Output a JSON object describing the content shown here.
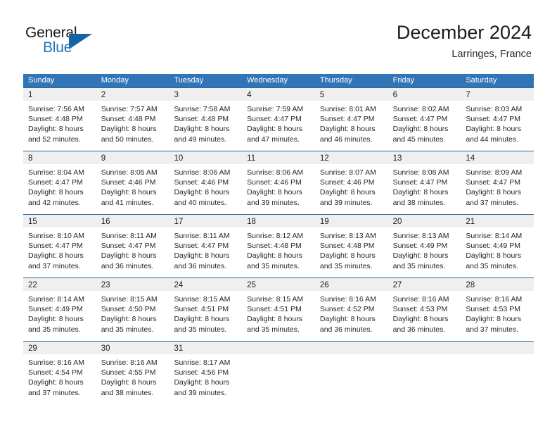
{
  "brand": {
    "name_part1": "General",
    "name_part2": "Blue",
    "flag_icon": "triangle-flag-icon"
  },
  "header": {
    "title": "December 2024",
    "location": "Larringes, France"
  },
  "colors": {
    "header_blue": "#3275b7",
    "row_border_blue": "#2a6aa8",
    "date_band_gray": "#efefef",
    "brand_blue": "#1f73b8",
    "text": "#262626"
  },
  "calendar": {
    "weekday_headers": [
      "Sunday",
      "Monday",
      "Tuesday",
      "Wednesday",
      "Thursday",
      "Friday",
      "Saturday"
    ],
    "weeks": [
      [
        {
          "day": "1",
          "lines": [
            "Sunrise: 7:56 AM",
            "Sunset: 4:48 PM",
            "Daylight: 8 hours",
            "and 52 minutes."
          ]
        },
        {
          "day": "2",
          "lines": [
            "Sunrise: 7:57 AM",
            "Sunset: 4:48 PM",
            "Daylight: 8 hours",
            "and 50 minutes."
          ]
        },
        {
          "day": "3",
          "lines": [
            "Sunrise: 7:58 AM",
            "Sunset: 4:48 PM",
            "Daylight: 8 hours",
            "and 49 minutes."
          ]
        },
        {
          "day": "4",
          "lines": [
            "Sunrise: 7:59 AM",
            "Sunset: 4:47 PM",
            "Daylight: 8 hours",
            "and 47 minutes."
          ]
        },
        {
          "day": "5",
          "lines": [
            "Sunrise: 8:01 AM",
            "Sunset: 4:47 PM",
            "Daylight: 8 hours",
            "and 46 minutes."
          ]
        },
        {
          "day": "6",
          "lines": [
            "Sunrise: 8:02 AM",
            "Sunset: 4:47 PM",
            "Daylight: 8 hours",
            "and 45 minutes."
          ]
        },
        {
          "day": "7",
          "lines": [
            "Sunrise: 8:03 AM",
            "Sunset: 4:47 PM",
            "Daylight: 8 hours",
            "and 44 minutes."
          ]
        }
      ],
      [
        {
          "day": "8",
          "lines": [
            "Sunrise: 8:04 AM",
            "Sunset: 4:47 PM",
            "Daylight: 8 hours",
            "and 42 minutes."
          ]
        },
        {
          "day": "9",
          "lines": [
            "Sunrise: 8:05 AM",
            "Sunset: 4:46 PM",
            "Daylight: 8 hours",
            "and 41 minutes."
          ]
        },
        {
          "day": "10",
          "lines": [
            "Sunrise: 8:06 AM",
            "Sunset: 4:46 PM",
            "Daylight: 8 hours",
            "and 40 minutes."
          ]
        },
        {
          "day": "11",
          "lines": [
            "Sunrise: 8:06 AM",
            "Sunset: 4:46 PM",
            "Daylight: 8 hours",
            "and 39 minutes."
          ]
        },
        {
          "day": "12",
          "lines": [
            "Sunrise: 8:07 AM",
            "Sunset: 4:46 PM",
            "Daylight: 8 hours",
            "and 39 minutes."
          ]
        },
        {
          "day": "13",
          "lines": [
            "Sunrise: 8:08 AM",
            "Sunset: 4:47 PM",
            "Daylight: 8 hours",
            "and 38 minutes."
          ]
        },
        {
          "day": "14",
          "lines": [
            "Sunrise: 8:09 AM",
            "Sunset: 4:47 PM",
            "Daylight: 8 hours",
            "and 37 minutes."
          ]
        }
      ],
      [
        {
          "day": "15",
          "lines": [
            "Sunrise: 8:10 AM",
            "Sunset: 4:47 PM",
            "Daylight: 8 hours",
            "and 37 minutes."
          ]
        },
        {
          "day": "16",
          "lines": [
            "Sunrise: 8:11 AM",
            "Sunset: 4:47 PM",
            "Daylight: 8 hours",
            "and 36 minutes."
          ]
        },
        {
          "day": "17",
          "lines": [
            "Sunrise: 8:11 AM",
            "Sunset: 4:47 PM",
            "Daylight: 8 hours",
            "and 36 minutes."
          ]
        },
        {
          "day": "18",
          "lines": [
            "Sunrise: 8:12 AM",
            "Sunset: 4:48 PM",
            "Daylight: 8 hours",
            "and 35 minutes."
          ]
        },
        {
          "day": "19",
          "lines": [
            "Sunrise: 8:13 AM",
            "Sunset: 4:48 PM",
            "Daylight: 8 hours",
            "and 35 minutes."
          ]
        },
        {
          "day": "20",
          "lines": [
            "Sunrise: 8:13 AM",
            "Sunset: 4:49 PM",
            "Daylight: 8 hours",
            "and 35 minutes."
          ]
        },
        {
          "day": "21",
          "lines": [
            "Sunrise: 8:14 AM",
            "Sunset: 4:49 PM",
            "Daylight: 8 hours",
            "and 35 minutes."
          ]
        }
      ],
      [
        {
          "day": "22",
          "lines": [
            "Sunrise: 8:14 AM",
            "Sunset: 4:49 PM",
            "Daylight: 8 hours",
            "and 35 minutes."
          ]
        },
        {
          "day": "23",
          "lines": [
            "Sunrise: 8:15 AM",
            "Sunset: 4:50 PM",
            "Daylight: 8 hours",
            "and 35 minutes."
          ]
        },
        {
          "day": "24",
          "lines": [
            "Sunrise: 8:15 AM",
            "Sunset: 4:51 PM",
            "Daylight: 8 hours",
            "and 35 minutes."
          ]
        },
        {
          "day": "25",
          "lines": [
            "Sunrise: 8:15 AM",
            "Sunset: 4:51 PM",
            "Daylight: 8 hours",
            "and 35 minutes."
          ]
        },
        {
          "day": "26",
          "lines": [
            "Sunrise: 8:16 AM",
            "Sunset: 4:52 PM",
            "Daylight: 8 hours",
            "and 36 minutes."
          ]
        },
        {
          "day": "27",
          "lines": [
            "Sunrise: 8:16 AM",
            "Sunset: 4:53 PM",
            "Daylight: 8 hours",
            "and 36 minutes."
          ]
        },
        {
          "day": "28",
          "lines": [
            "Sunrise: 8:16 AM",
            "Sunset: 4:53 PM",
            "Daylight: 8 hours",
            "and 37 minutes."
          ]
        }
      ],
      [
        {
          "day": "29",
          "lines": [
            "Sunrise: 8:16 AM",
            "Sunset: 4:54 PM",
            "Daylight: 8 hours",
            "and 37 minutes."
          ]
        },
        {
          "day": "30",
          "lines": [
            "Sunrise: 8:16 AM",
            "Sunset: 4:55 PM",
            "Daylight: 8 hours",
            "and 38 minutes."
          ]
        },
        {
          "day": "31",
          "lines": [
            "Sunrise: 8:17 AM",
            "Sunset: 4:56 PM",
            "Daylight: 8 hours",
            "and 39 minutes."
          ]
        },
        {
          "day": "",
          "lines": []
        },
        {
          "day": "",
          "lines": []
        },
        {
          "day": "",
          "lines": []
        },
        {
          "day": "",
          "lines": []
        }
      ]
    ]
  }
}
